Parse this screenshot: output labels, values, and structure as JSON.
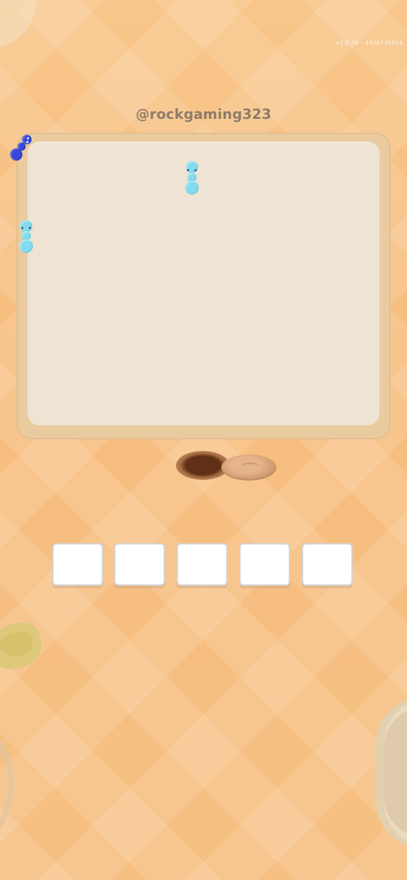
{
  "hud": {
    "build_code": "v1.0.36 - 4908736454",
    "watermark": "@rockgaming323"
  },
  "board": {
    "ants": [
      {
        "color": "cyan-ant"
      },
      {
        "color": "cyan-ant"
      },
      {
        "color": "blue-ant"
      }
    ]
  },
  "slots": [
    {
      "label": ""
    },
    {
      "label": ""
    },
    {
      "label": ""
    },
    {
      "label": ""
    },
    {
      "label": ""
    }
  ],
  "colors": {
    "background": "#f6be7f",
    "board_frame": "#e9cb9f",
    "board_inner": "#efe3d3",
    "cyan_ant": "#83dbeb",
    "blue_ant": "#3949d6",
    "slot_fill": "#ffffff"
  }
}
